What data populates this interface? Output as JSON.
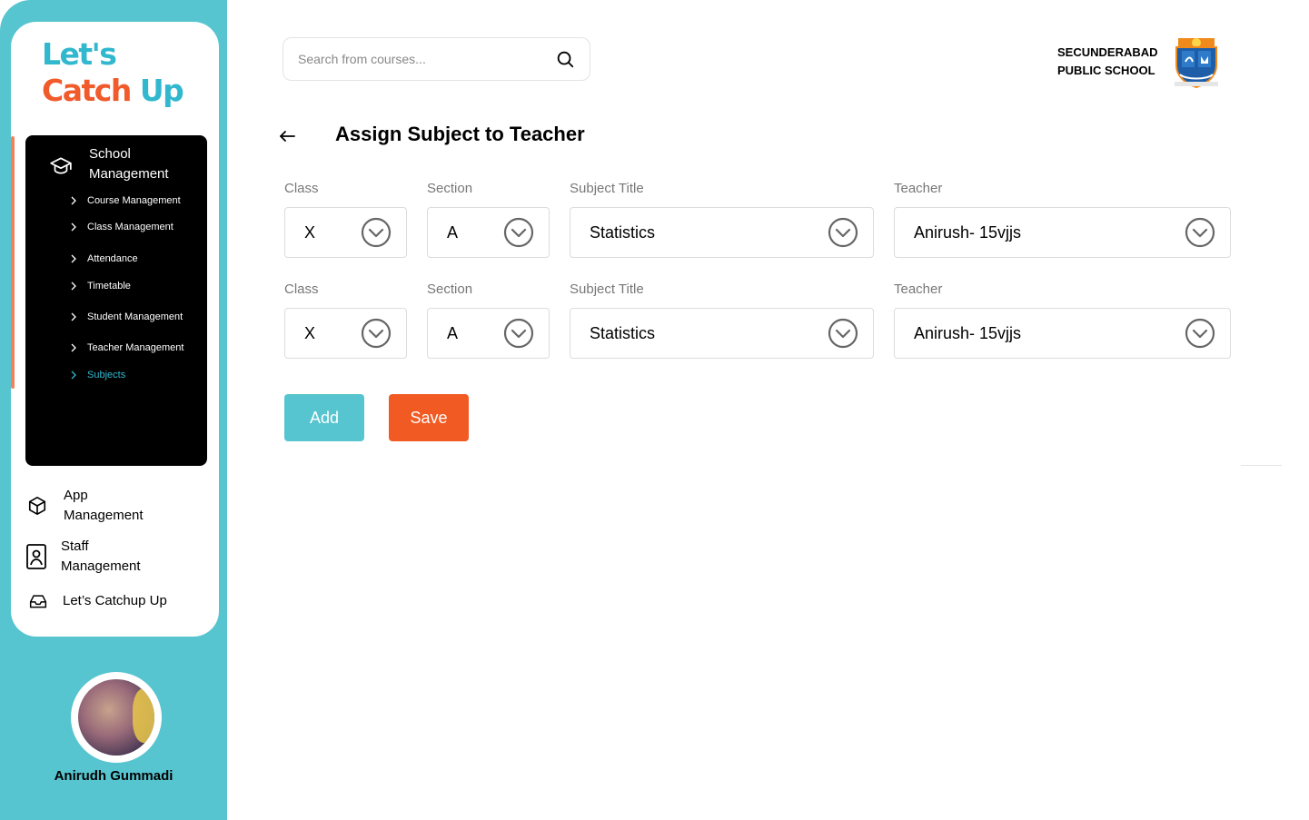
{
  "app": {
    "logo_line1": "Let's",
    "logo_line2a": "Catch ",
    "logo_line2b": "Up"
  },
  "sidebar": {
    "section_title": "School Management",
    "menu": [
      {
        "label": "Course Management",
        "active": false
      },
      {
        "label": "Class Management",
        "active": false
      },
      {
        "label": "Attendance",
        "active": false
      },
      {
        "label": "Timetable",
        "active": false
      },
      {
        "label": "Student Management",
        "active": false
      },
      {
        "label": "Teacher Management",
        "active": false
      },
      {
        "label": "Subjects",
        "active": true
      }
    ],
    "links": [
      {
        "label": "App Management",
        "icon": "cube-icon"
      },
      {
        "label": "Staff Management",
        "icon": "id-card-icon"
      },
      {
        "label": "Let’s Catchup Up",
        "icon": "inbox-icon"
      }
    ],
    "user_name": "Anirudh Gummadi"
  },
  "header": {
    "search_placeholder": "Search from courses...",
    "school_line1": "SECUNDERABAD",
    "school_line2": "PUBLIC SCHOOL"
  },
  "page": {
    "title": "Assign Subject to Teacher",
    "rows": [
      {
        "class_label": "Class",
        "class_value": "X",
        "section_label": "Section",
        "section_value": "A",
        "subject_label": "Subject Title",
        "subject_value": "Statistics",
        "teacher_label": "Teacher",
        "teacher_value": "Anirush- 15vjjs"
      },
      {
        "class_label": "Class",
        "class_value": "X",
        "section_label": "Section",
        "section_value": "A",
        "subject_label": "Subject Title",
        "subject_value": "Statistics",
        "teacher_label": "Teacher",
        "teacher_value": "Anirush- 15vjjs"
      }
    ],
    "add_label": "Add",
    "save_label": "Save"
  },
  "colors": {
    "brand_teal": "#56c5d0",
    "brand_orange": "#f15a22",
    "active_menu": "#31b8cf"
  }
}
